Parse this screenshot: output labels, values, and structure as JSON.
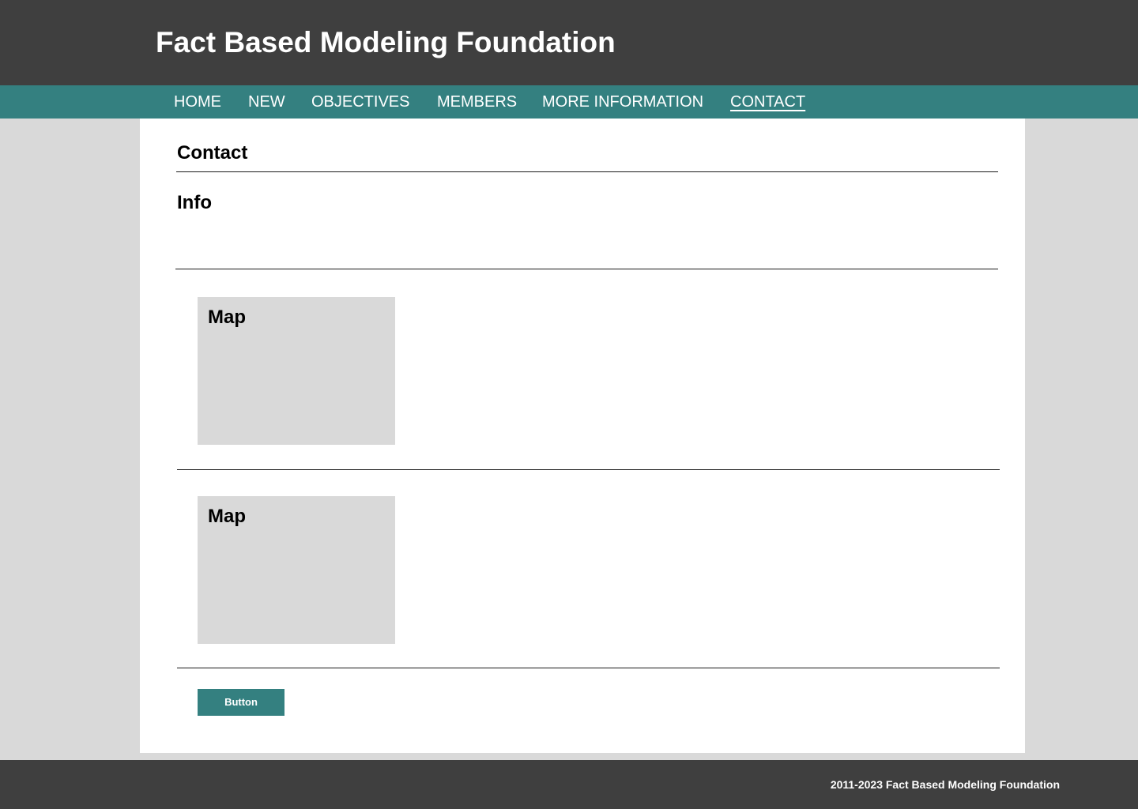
{
  "header": {
    "title": "Fact Based Modeling Foundation"
  },
  "nav": {
    "items": [
      {
        "label": "HOME"
      },
      {
        "label": "NEW"
      },
      {
        "label": "OBJECTIVES"
      },
      {
        "label": "MEMBERS"
      },
      {
        "label": "MORE INFORMATION"
      },
      {
        "label": "CONTACT",
        "active": true
      }
    ]
  },
  "main": {
    "title": "Contact",
    "info_heading": "Info",
    "maps": [
      {
        "label": "Map"
      },
      {
        "label": "Map"
      }
    ],
    "button_label": "Button"
  },
  "footer": {
    "text": "2011-2023 Fact Based Modeling Foundation"
  },
  "colors": {
    "header_bg": "#3f3f3f",
    "nav_bg": "#348080",
    "page_bg": "#d9d9d9",
    "content_bg": "#ffffff",
    "accent": "#348080"
  }
}
